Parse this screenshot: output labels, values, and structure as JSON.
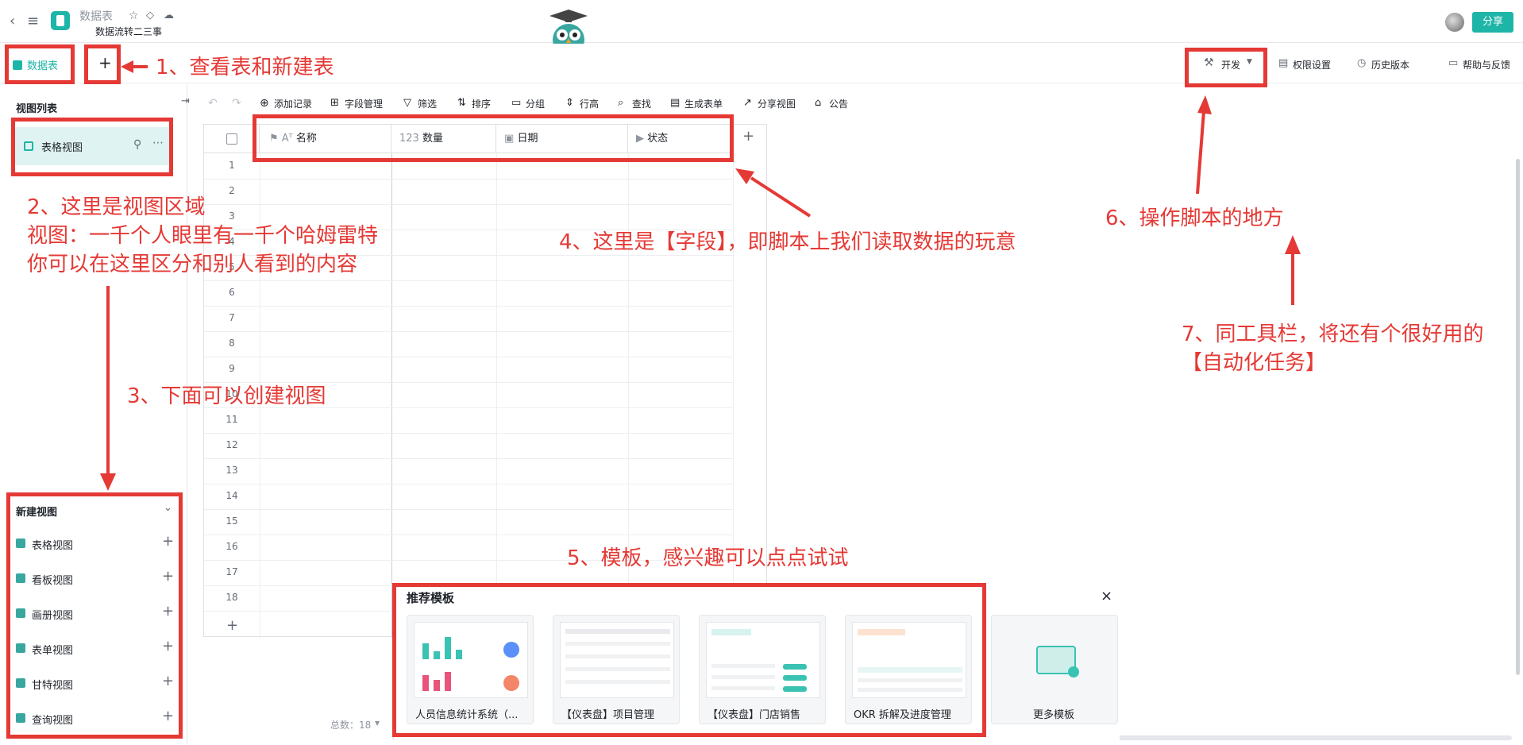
{
  "header": {
    "doc_title": "数据表",
    "doc_subtitle": "数据流转二三事",
    "share_label": "分享"
  },
  "tabs": {
    "active_table": "数据表",
    "add_label": "+"
  },
  "right_tools": {
    "develop": "开发",
    "permissions": "权限设置",
    "history": "历史版本",
    "help": "帮助与反馈"
  },
  "sidebar": {
    "views_title": "视图列表",
    "current_view": "表格视图",
    "new_view_title": "新建视图",
    "new_views": [
      "表格视图",
      "看板视图",
      "画册视图",
      "表单视图",
      "甘特视图",
      "查询视图"
    ],
    "total_label": "总数：18"
  },
  "toolbar": {
    "add_record": "添加记录",
    "field_manage": "字段管理",
    "filter": "筛选",
    "sort": "排序",
    "group": "分组",
    "row_height": "行高",
    "search": "查找",
    "gen_form": "生成表单",
    "share_view": "分享视图",
    "notice": "公告"
  },
  "grid": {
    "columns": [
      "名称",
      "数量",
      "日期",
      "状态"
    ],
    "rows": [
      "1",
      "2",
      "3",
      "4",
      "5",
      "6",
      "7",
      "8",
      "9",
      "10",
      "11",
      "12",
      "13",
      "14",
      "15",
      "16",
      "17",
      "18"
    ],
    "add_row": "+",
    "add_col": "+"
  },
  "templates": {
    "title": "推荐模板",
    "close": "×",
    "items": [
      "人员信息统计系统（...",
      "【仪表盘】项目管理",
      "【仪表盘】门店销售",
      "OKR 拆解及进度管理",
      "更多模板"
    ]
  },
  "annotations": {
    "a1": "1、查看表和新建表",
    "a2_line1": "2、这里是视图区域",
    "a2_line2": "视图：一千个人眼里有一千个哈姆雷特",
    "a2_line3": "你可以在这里区分和别人看到的内容",
    "a3": "3、下面可以创建视图",
    "a4": "4、这里是【字段】，即脚本上我们读取数据的玩意",
    "a5": "5、模板，感兴趣可以点点试试",
    "a6": "6、操作脚本的地方",
    "a7_line1": "7、同工具栏，将还有个很好用的",
    "a7_line2": "【自动化任务】"
  },
  "colors": {
    "accent": "#1db5a7",
    "annotation": "#e53935"
  }
}
